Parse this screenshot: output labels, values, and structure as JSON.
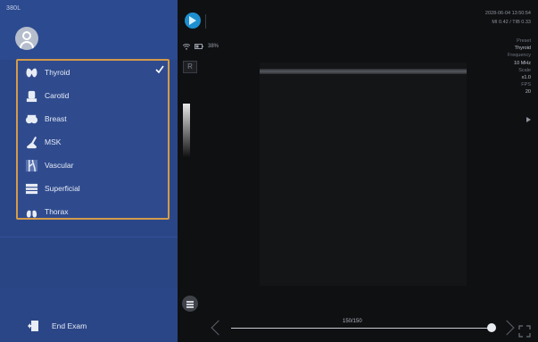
{
  "sidebar": {
    "model": "380L",
    "presets": [
      {
        "label": "Thyroid",
        "icon": "thyroid-icon",
        "selected": true
      },
      {
        "label": "Carotid",
        "icon": "carotid-icon",
        "selected": false
      },
      {
        "label": "Breast",
        "icon": "breast-icon",
        "selected": false
      },
      {
        "label": "MSK",
        "icon": "msk-icon",
        "selected": false
      },
      {
        "label": "Vascular",
        "icon": "vascular-icon",
        "selected": false
      },
      {
        "label": "Superficial",
        "icon": "superficial-icon",
        "selected": false
      },
      {
        "label": "Thorax",
        "icon": "thorax-icon",
        "selected": false
      }
    ],
    "end_exam_label": "End Exam"
  },
  "status": {
    "battery": "38%"
  },
  "image": {
    "orientation_marker": "R"
  },
  "info": {
    "datetime": "2028-06-04 13:50:54",
    "mi_tib": "MI 0.42 / TIB 0.33"
  },
  "params": [
    {
      "key": "Preset",
      "value": "Thyroid"
    },
    {
      "key": "Frequency",
      "value": "10 MHz"
    },
    {
      "key": "Scale",
      "value": "x1.0"
    },
    {
      "key": "FPS",
      "value": "20"
    }
  ],
  "cine": {
    "frame_label": "150/150",
    "progress": 1.0
  },
  "colors": {
    "sidebar": "#2b4687",
    "selection_border": "#d49b4a",
    "accent": "#1d8fcf"
  }
}
